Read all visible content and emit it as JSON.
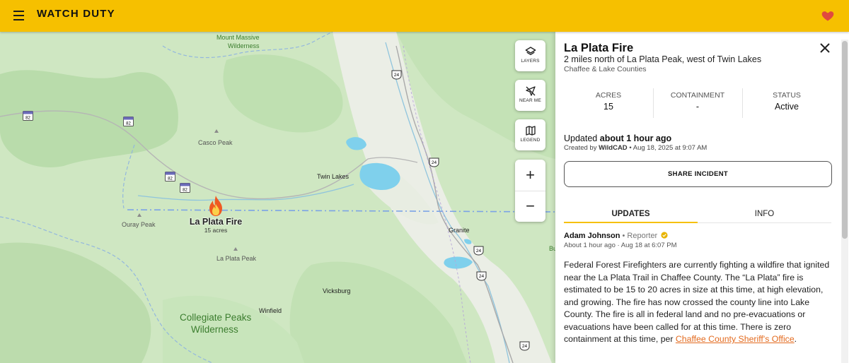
{
  "header": {
    "brand": "WATCH DUTY",
    "menu_icon": "hamburger-menu-icon",
    "favorite_icon": "heart-icon",
    "accent_color": "#f6c000"
  },
  "map": {
    "labels": {
      "mount_massive_1": "Mount Massive",
      "mount_massive_2": "Wilderness",
      "casco_peak": "Casco Peak",
      "twin_lakes": "Twin Lakes",
      "ouray_peak": "Ouray Peak",
      "la_plata_peak": "La Plata Peak",
      "granite": "Granite",
      "vicksburg": "Vicksburg",
      "winfield": "Winfield",
      "collegiate_1": "Collegiate Peaks",
      "collegiate_2": "Wilderness",
      "edge_label": "Bu"
    },
    "highways": {
      "us24": "24",
      "co82": "82"
    },
    "fire_marker": {
      "name": "La Plata Fire",
      "acres": "15 acres",
      "icon": "fire-icon"
    },
    "controls": {
      "layers": "LAYERS",
      "near_me": "NEAR ME",
      "legend": "LEGEND",
      "zoom_in": "+",
      "zoom_out": "−"
    }
  },
  "incident": {
    "title": "La Plata Fire",
    "location": "2 miles north of La Plata Peak, west of Twin Lakes",
    "counties": "Chaffee & Lake Counties",
    "stats": [
      {
        "label": "ACRES",
        "value": "15"
      },
      {
        "label": "CONTAINMENT",
        "value": "-"
      },
      {
        "label": "STATUS",
        "value": "Active"
      }
    ],
    "updated_prefix": "Updated",
    "updated_ago": "about 1 hour ago",
    "created_prefix": "Created by",
    "created_by": "WildCAD",
    "created_suffix": "• Aug 18, 2025 at 9:07 AM",
    "share_label": "SHARE INCIDENT",
    "tabs": [
      {
        "label": "UPDATES",
        "active": true
      },
      {
        "label": "INFO",
        "active": false
      }
    ],
    "update": {
      "author": "Adam Johnson",
      "role": "• Reporter",
      "time": "About 1 hour ago · Aug 18 at 6:07 PM",
      "body": "Federal Forest Firefighters are currently fighting a wildfire that ignited near the La Plata Trail in Chaffee County. The “La Plata” fire is estimated to be 15 to 20 acres in size at this time, at high elevation, and growing. The fire has now crossed the county line into Lake County. The fire is all in federal land and no pre-evacuations or evacuations have been called for at this time. There is zero containment at this time, per ",
      "link_text": "Chaffee County Sheriff's Office",
      "tail": "."
    }
  }
}
